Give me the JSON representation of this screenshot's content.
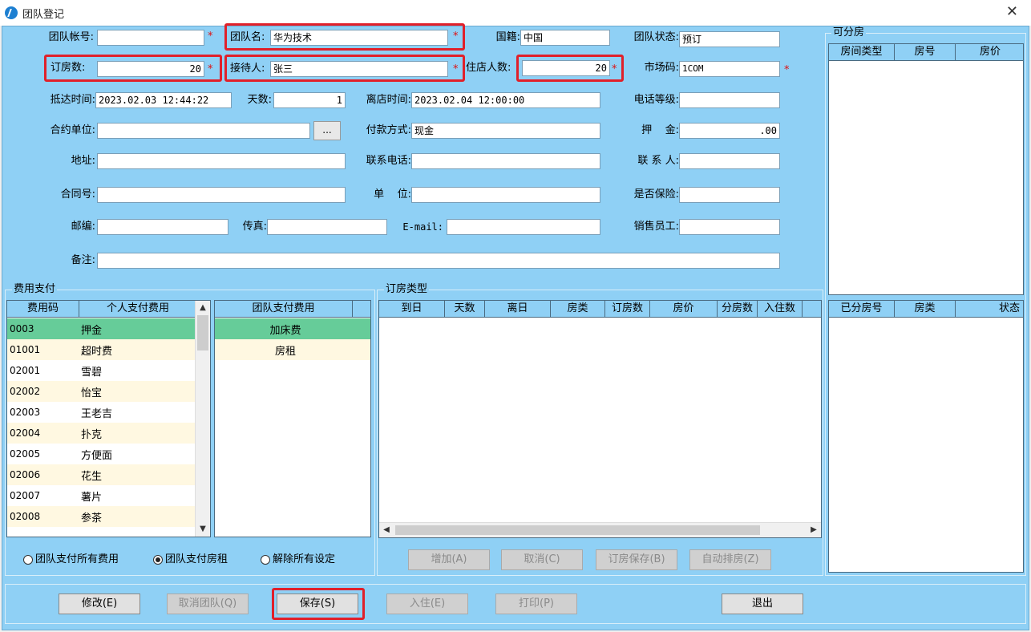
{
  "window": {
    "title": "团队登记",
    "close_glyph": "✕"
  },
  "form": {
    "team_account": {
      "label": "团队帐号:",
      "value": ""
    },
    "team_name": {
      "label": "团队名:",
      "value": "华为技术"
    },
    "nationality": {
      "label": "国籍:",
      "value": "中国"
    },
    "team_status": {
      "label": "团队状态:",
      "value": "预订"
    },
    "booked_rooms": {
      "label": "订房数:",
      "value": "20"
    },
    "receptionist": {
      "label": "接待人:",
      "value": "张三"
    },
    "guest_count": {
      "label": "住店人数:",
      "value": "20"
    },
    "market_code": {
      "label": "市场码:",
      "value": "1COM"
    },
    "arrival_time": {
      "label": "抵达时间:",
      "value": "2023.02.03 12:44:22"
    },
    "days": {
      "label": "天数:",
      "value": "1"
    },
    "departure_time": {
      "label": "离店时间:",
      "value": "2023.02.04 12:00:00"
    },
    "phone_level": {
      "label": "电话等级:",
      "value": ""
    },
    "contract_unit": {
      "label": "合约单位:",
      "value": "",
      "browse_label": "..."
    },
    "payment_method": {
      "label": "付款方式:",
      "value": "现金"
    },
    "deposit": {
      "label": "押    金:",
      "value": ".00"
    },
    "address": {
      "label": "地址:",
      "value": ""
    },
    "contact_phone": {
      "label": "联系电话:",
      "value": ""
    },
    "contact_person": {
      "label": "联 系 人:",
      "value": ""
    },
    "contract_no": {
      "label": "合同号:",
      "value": ""
    },
    "unit": {
      "label": "单    位:",
      "value": ""
    },
    "insured": {
      "label": "是否保险:",
      "value": ""
    },
    "postcode": {
      "label": "邮编:",
      "value": ""
    },
    "fax": {
      "label": "传真:",
      "value": ""
    },
    "email": {
      "label": "E-mail:",
      "value": ""
    },
    "sales_staff": {
      "label": "销售员工:",
      "value": ""
    },
    "remarks": {
      "label": "备注:",
      "value": ""
    },
    "required_mark": "*"
  },
  "fee_payment": {
    "title": "费用支付",
    "personal_headers": [
      "费用码",
      "个人支付费用"
    ],
    "personal_rows": [
      {
        "code": "0003",
        "name": "押金"
      },
      {
        "code": "01001",
        "name": "超时费"
      },
      {
        "code": "02001",
        "name": "雪碧"
      },
      {
        "code": "02002",
        "name": "怡宝"
      },
      {
        "code": "02003",
        "name": "王老吉"
      },
      {
        "code": "02004",
        "name": "扑克"
      },
      {
        "code": "02005",
        "name": "方便面"
      },
      {
        "code": "02006",
        "name": "花生"
      },
      {
        "code": "02007",
        "name": "薯片"
      },
      {
        "code": "02008",
        "name": "参茶"
      }
    ],
    "team_header": "团队支付费用",
    "team_rows": [
      "加床费",
      "房租"
    ],
    "radio_options": [
      "团队支付所有费用",
      "团队支付房租",
      "解除所有设定"
    ],
    "selected_radio": "团队支付房租"
  },
  "booking_types": {
    "title": "订房类型",
    "headers": [
      "到日",
      "天数",
      "离日",
      "房类",
      "订房数",
      "房价",
      "分房数",
      "入住数"
    ],
    "buttons": [
      "增加(A)",
      "取消(C)",
      "订房保存(B)",
      "自动排房(Z)"
    ]
  },
  "available_rooms": {
    "title": "可分房",
    "headers": [
      "房间类型",
      "房号",
      "房价"
    ]
  },
  "assigned_rooms": {
    "headers": [
      "已分房号",
      "房类",
      "状态"
    ]
  },
  "bottom_buttons": {
    "modify": "修改(E)",
    "cancel_team": "取消团队(Q)",
    "save": "保存(S)",
    "checkin": "入住(E)",
    "print": "打印(P)",
    "exit": "退出"
  },
  "colors": {
    "client_bg": "#8fd0f5",
    "highlight_border": "#e0202a",
    "selected_row": "#66cc99",
    "alt_row": "#fff8e1"
  }
}
